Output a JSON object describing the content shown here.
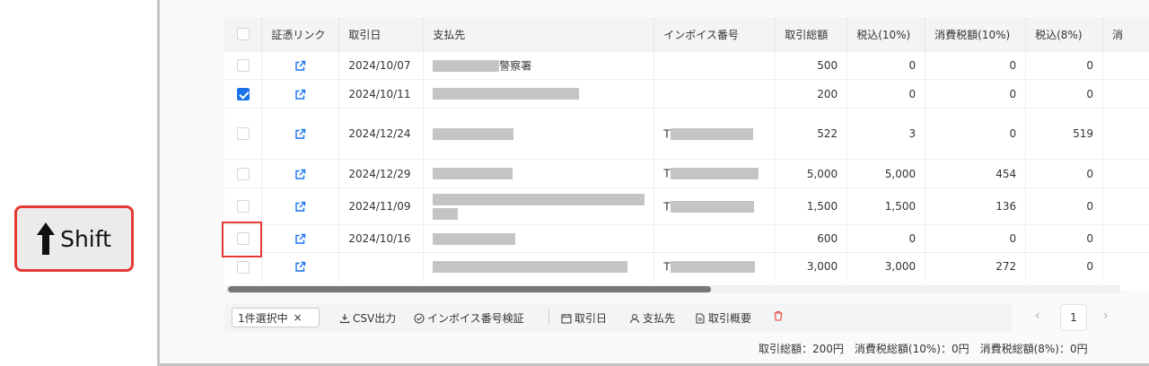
{
  "annotation": {
    "key_label": "Shift",
    "plus": "+"
  },
  "table": {
    "headers": [
      "",
      "証憑リンク",
      "取引日",
      "支払先",
      "インボイス番号",
      "取引総額",
      "税込(10%)",
      "消費税額(10%)",
      "税込(8%)",
      "消"
    ],
    "rows": [
      {
        "checked": false,
        "date": "2024/10/07",
        "payee_suffix": "警察署",
        "invoice_prefix": "",
        "total": "500",
        "tax10": "0",
        "ctax10": "0",
        "tax8": "0"
      },
      {
        "checked": true,
        "date": "2024/10/11",
        "payee_suffix": "",
        "invoice_prefix": "",
        "total": "200",
        "tax10": "0",
        "ctax10": "0",
        "tax8": "0"
      },
      {
        "checked": false,
        "date": "2024/12/24",
        "payee_suffix": "",
        "invoice_prefix": "T",
        "total": "522",
        "tax10": "3",
        "ctax10": "0",
        "tax8": "519"
      },
      {
        "checked": false,
        "date": "2024/12/29",
        "payee_suffix": "",
        "invoice_prefix": "T",
        "total": "5,000",
        "tax10": "5,000",
        "ctax10": "454",
        "tax8": "0"
      },
      {
        "checked": false,
        "date": "2024/11/09",
        "payee_suffix": "",
        "invoice_prefix": "T",
        "total": "1,500",
        "tax10": "1,500",
        "ctax10": "136",
        "tax8": "0"
      },
      {
        "checked": false,
        "date": "2024/10/16",
        "payee_suffix": "",
        "invoice_prefix": "",
        "total": "600",
        "tax10": "0",
        "ctax10": "0",
        "tax8": "0"
      },
      {
        "checked": false,
        "date": "",
        "payee_suffix": "",
        "invoice_prefix": "T",
        "total": "3,000",
        "tax10": "3,000",
        "ctax10": "272",
        "tax8": "0"
      }
    ]
  },
  "actions": {
    "selection": "1件選択中",
    "clear": "×",
    "csv": "CSV出力",
    "verify": "インボイス番号検証",
    "date": "取引日",
    "payee": "支払先",
    "summary": "取引概要"
  },
  "pager": {
    "prev": "‹",
    "page": "1",
    "next": "›"
  },
  "totals": "取引総額：200円　消費税総額(10%)：0円　消費税総額(8%)：0円",
  "colors": {
    "accent": "#1a73e8",
    "highlight": "#e53935",
    "delete": "#e53935"
  }
}
